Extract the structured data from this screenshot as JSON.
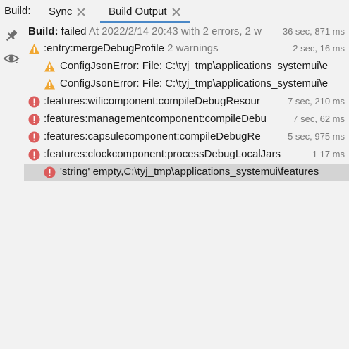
{
  "tabbar": {
    "prefix": "Build:",
    "tabs": [
      {
        "label": "Sync",
        "active": false
      },
      {
        "label": "Build Output",
        "active": true
      }
    ]
  },
  "toolbar": {
    "pin_icon": "pin-icon",
    "eye_icon": "eye-icon"
  },
  "tree": {
    "rows": [
      {
        "indent": 0,
        "icon": "none",
        "prefix": "Build:",
        "text": " failed",
        "detail": " At 2022/2/14 20:43 with 2 errors, 2 w",
        "time": "36 sec, 871 ms"
      },
      {
        "indent": 0,
        "icon": "warning-icon",
        "text": ":entry:mergeDebugProfile",
        "detail": "2 warnings",
        "time": "2 sec, 16 ms"
      },
      {
        "indent": 1,
        "icon": "warning-icon",
        "text": "ConfigJsonError:  File: C:\\tyj_tmp\\applications_systemui\\e",
        "time": ""
      },
      {
        "indent": 1,
        "icon": "warning-icon",
        "text": "ConfigJsonError:  File: C:\\tyj_tmp\\applications_systemui\\e",
        "time": ""
      },
      {
        "indent": 0,
        "icon": "error-icon",
        "text": ":features:wificomponent:compileDebugResour",
        "time": "7 sec, 210 ms"
      },
      {
        "indent": 0,
        "icon": "error-icon",
        "text": ":features:managementcomponent:compileDebu",
        "time": "7 sec, 62 ms"
      },
      {
        "indent": 0,
        "icon": "error-icon",
        "text": ":features:capsulecomponent:compileDebugRe",
        "time": "5 sec, 975 ms"
      },
      {
        "indent": 0,
        "icon": "error-icon",
        "text": ":features:clockcomponent:processDebugLocalJars",
        "time": "1  17 ms"
      },
      {
        "indent": 1,
        "icon": "error-icon",
        "text": "'string' empty,C:\\tyj_tmp\\applications_systemui\\features",
        "time": "",
        "selected": true
      }
    ]
  },
  "colors": {
    "warning": "#f0a732",
    "error": "#db5c5c",
    "selection": "#d4d4d4",
    "tab_underline": "#4a88c7"
  }
}
